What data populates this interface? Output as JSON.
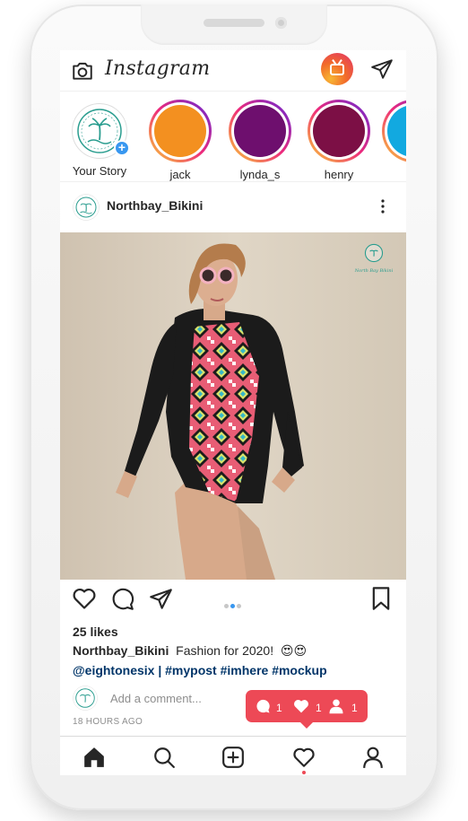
{
  "app": {
    "brand": "Instagram"
  },
  "header": {
    "icons": [
      "camera-icon",
      "igtv-icon",
      "send-icon"
    ]
  },
  "stories": [
    {
      "label": "Your Story",
      "own": true,
      "color": "#ffffff"
    },
    {
      "label": "jack",
      "color": "#f39020"
    },
    {
      "label": "lynda_s",
      "color": "#6e0f6e"
    },
    {
      "label": "henry",
      "color": "#7c0f45"
    },
    {
      "label": "",
      "color": "#12a9e0"
    }
  ],
  "post": {
    "username": "Northbay_Bikini",
    "watermark": "North Bay Bikini",
    "likes": "25 likes",
    "caption_user": "Northbay_Bikini",
    "caption_text": "Fashion for 2020!",
    "caption_emoji": "😍😍",
    "tags": "@eightonesix | #mypost #imhere #mockup",
    "add_comment_placeholder": "Add a comment...",
    "time": "18 HOURS AGO",
    "carousel_count": 3,
    "carousel_active": 1
  },
  "notifications": {
    "comments": "1",
    "likes": "1",
    "follows": "1"
  },
  "nav": {
    "items": [
      "home-icon",
      "search-icon",
      "new-post-icon",
      "activity-icon",
      "profile-icon"
    ],
    "active": "home"
  },
  "colors": {
    "accent": "#3897f0",
    "badge": "#ed4956",
    "brand_teal": "#2a9d8f"
  }
}
